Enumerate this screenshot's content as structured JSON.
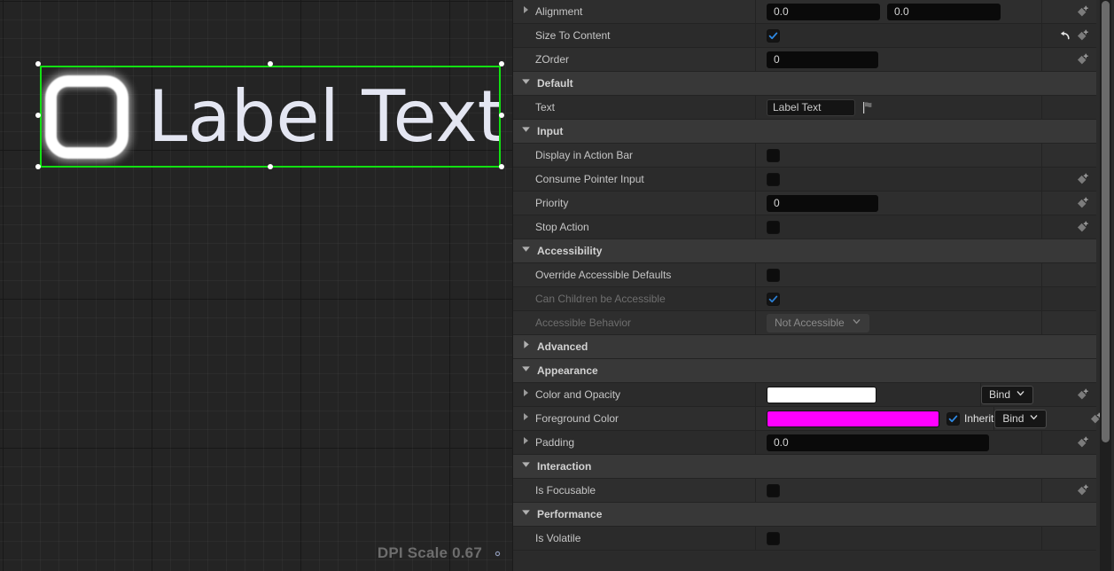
{
  "canvas": {
    "widget": {
      "label": "Label Text",
      "icon": "checkbox-unchecked-glyph",
      "selection_color": "#12E012"
    },
    "dpi_scale_label": "DPI Scale 0.67",
    "dpi_gear_icon": "gear-icon"
  },
  "details": {
    "sections": [
      {
        "id": "top-partial",
        "type": "rows",
        "rows": [
          {
            "id": "alignment",
            "label": "Alignment",
            "expandable": true,
            "control": "vector2",
            "values": [
              "0.0",
              "0.0"
            ],
            "keyframe": true,
            "reset": false
          },
          {
            "id": "size-to-content",
            "label": "Size To Content",
            "expandable": false,
            "control": "checkbox",
            "checked": true,
            "keyframe": true,
            "reset": true
          },
          {
            "id": "zorder",
            "label": "ZOrder",
            "expandable": false,
            "control": "number",
            "value": "0",
            "keyframe": true,
            "reset": false
          }
        ]
      },
      {
        "id": "default",
        "type": "category",
        "title": "Default",
        "expanded": true,
        "rows": [
          {
            "id": "text",
            "label": "Text",
            "expandable": false,
            "control": "text",
            "value": "Label Text",
            "flag_icon": "localization-flag-icon",
            "keyframe": false,
            "reset": false
          }
        ]
      },
      {
        "id": "input",
        "type": "category",
        "title": "Input",
        "expanded": true,
        "rows": [
          {
            "id": "display-in-action-bar",
            "label": "Display in Action Bar",
            "expandable": false,
            "control": "checkbox",
            "checked": false,
            "keyframe": false,
            "reset": false
          },
          {
            "id": "consume-pointer-input",
            "label": "Consume Pointer Input",
            "expandable": false,
            "control": "checkbox",
            "checked": false,
            "keyframe": true,
            "reset": false
          },
          {
            "id": "priority",
            "label": "Priority",
            "expandable": false,
            "control": "number",
            "value": "0",
            "keyframe": true,
            "reset": false
          },
          {
            "id": "stop-action",
            "label": "Stop Action",
            "expandable": false,
            "control": "checkbox",
            "checked": false,
            "keyframe": true,
            "reset": false
          }
        ]
      },
      {
        "id": "accessibility",
        "type": "category",
        "title": "Accessibility",
        "expanded": true,
        "rows": [
          {
            "id": "override-accessible-defaults",
            "label": "Override Accessible Defaults",
            "expandable": false,
            "control": "checkbox",
            "checked": false,
            "disabled": false,
            "keyframe": false,
            "reset": false
          },
          {
            "id": "can-children-be-accessible",
            "label": "Can Children be Accessible",
            "expandable": false,
            "control": "checkbox",
            "checked": true,
            "disabled": true,
            "keyframe": false,
            "reset": false
          },
          {
            "id": "accessible-behavior",
            "label": "Accessible Behavior",
            "expandable": false,
            "control": "combo",
            "value": "Not Accessible",
            "disabled": true,
            "keyframe": false,
            "reset": false
          }
        ]
      },
      {
        "id": "advanced",
        "type": "category",
        "title": "Advanced",
        "expanded": false,
        "rows": []
      },
      {
        "id": "appearance",
        "type": "category",
        "title": "Appearance",
        "expanded": true,
        "rows": [
          {
            "id": "color-and-opacity",
            "label": "Color and Opacity",
            "expandable": true,
            "control": "color",
            "color": "#FFFFFF",
            "bind_label": "Bind",
            "keyframe": true,
            "reset": false
          },
          {
            "id": "foreground-color",
            "label": "Foreground Color",
            "expandable": true,
            "control": "color-inherit",
            "color": "#FF00FF",
            "inherit_label": "Inherit",
            "inherit_checked": true,
            "bind_label": "Bind",
            "keyframe": true,
            "reset": false
          },
          {
            "id": "padding",
            "label": "Padding",
            "expandable": true,
            "control": "number-wide",
            "value": "0.0",
            "keyframe": true,
            "reset": false
          }
        ]
      },
      {
        "id": "interaction",
        "type": "category",
        "title": "Interaction",
        "expanded": true,
        "rows": [
          {
            "id": "is-focusable",
            "label": "Is Focusable",
            "expandable": false,
            "control": "checkbox",
            "checked": false,
            "keyframe": true,
            "reset": false
          }
        ]
      },
      {
        "id": "performance",
        "type": "category",
        "title": "Performance",
        "expanded": true,
        "rows": [
          {
            "id": "is-volatile",
            "label": "Is Volatile",
            "expandable": false,
            "control": "checkbox",
            "checked": false,
            "keyframe": false,
            "reset": false
          }
        ]
      }
    ],
    "scrollbar": {
      "name": "details-scrollbar"
    }
  }
}
